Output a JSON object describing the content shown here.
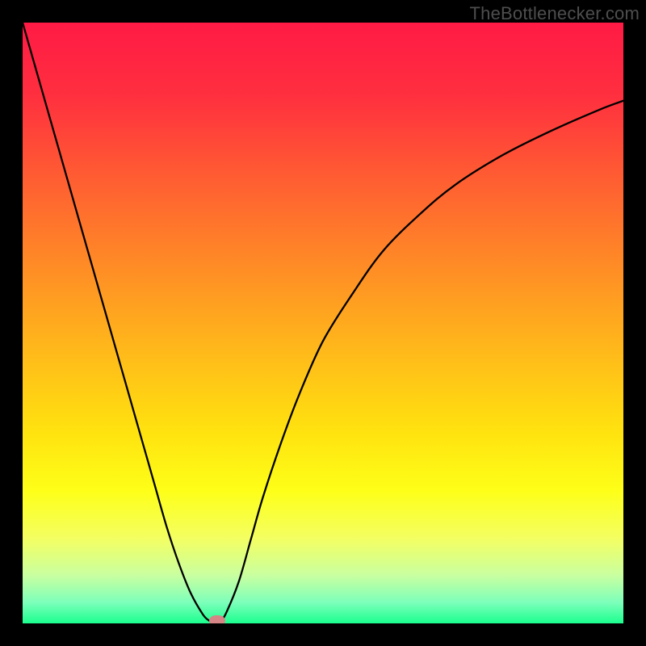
{
  "watermark": {
    "text": "TheBottlenecker.com"
  },
  "chart_data": {
    "type": "line",
    "title": "",
    "xlabel": "",
    "ylabel": "",
    "xlim": [
      0,
      100
    ],
    "ylim": [
      0,
      100
    ],
    "axes_visible": false,
    "grid": false,
    "legend": false,
    "background_gradient": {
      "direction": "vertical",
      "stops": [
        {
          "pos": 0.0,
          "color": "#ff1a45"
        },
        {
          "pos": 0.12,
          "color": "#ff2f3f"
        },
        {
          "pos": 0.25,
          "color": "#ff5a33"
        },
        {
          "pos": 0.4,
          "color": "#ff8a26"
        },
        {
          "pos": 0.55,
          "color": "#ffba1a"
        },
        {
          "pos": 0.68,
          "color": "#ffe20f"
        },
        {
          "pos": 0.78,
          "color": "#feff18"
        },
        {
          "pos": 0.86,
          "color": "#f3ff63"
        },
        {
          "pos": 0.92,
          "color": "#c9ffa0"
        },
        {
          "pos": 0.965,
          "color": "#7dffbb"
        },
        {
          "pos": 1.0,
          "color": "#1bff8e"
        }
      ]
    },
    "series": [
      {
        "name": "bottleneck-curve",
        "stroke": "#000000",
        "stroke_width": 2.3,
        "x": [
          0,
          2,
          4,
          6,
          8,
          10,
          12,
          14,
          16,
          18,
          20,
          22,
          24,
          26,
          28,
          30,
          31,
          32,
          32.8,
          34,
          36,
          38,
          40,
          43,
          46,
          50,
          55,
          60,
          66,
          72,
          80,
          88,
          96,
          100
        ],
        "values": [
          100,
          93,
          86,
          79,
          72,
          65,
          58,
          51,
          44,
          37,
          30,
          23,
          16,
          10,
          5,
          1.5,
          0.5,
          0,
          0,
          2,
          7,
          14,
          21,
          30,
          38,
          47,
          55,
          62,
          68,
          73,
          78,
          82,
          85.5,
          87
        ]
      }
    ],
    "annotations": [
      {
        "name": "min-marker",
        "shape": "ellipse",
        "x": 32.4,
        "y": 0.4,
        "rx": 1.3,
        "ry": 0.9,
        "fill": "#d58585"
      }
    ]
  }
}
